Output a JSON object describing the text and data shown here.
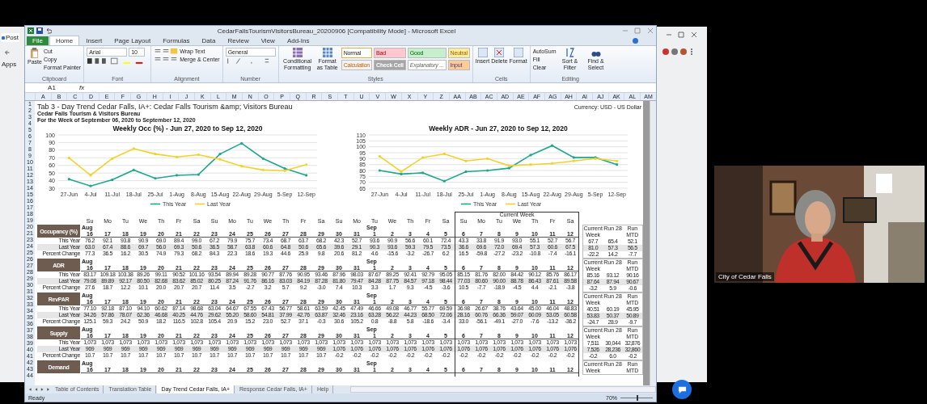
{
  "browser": {
    "tab_title": "Post",
    "bookmark": "Apps"
  },
  "excel": {
    "title": "CedarFallsTourismVisitorsBureau_20200906 [Compatibility Mode] - Microsoft Excel",
    "ribbon_tabs": [
      {
        "label": "File",
        "kind": "file",
        "selected": false
      },
      {
        "label": "Home",
        "kind": "tab",
        "selected": true
      },
      {
        "label": "Insert",
        "kind": "tab",
        "selected": false
      },
      {
        "label": "Page Layout",
        "kind": "tab",
        "selected": false
      },
      {
        "label": "Formulas",
        "kind": "tab",
        "selected": false
      },
      {
        "label": "Data",
        "kind": "tab",
        "selected": false
      },
      {
        "label": "Review",
        "kind": "tab",
        "selected": false
      },
      {
        "label": "View",
        "kind": "tab",
        "selected": false
      },
      {
        "label": "Add-Ins",
        "kind": "tab",
        "selected": false
      }
    ],
    "clipboard": {
      "paste": "Paste",
      "cut": "Cut",
      "copy": "Copy",
      "format_painter": "Format Painter",
      "label": "Clipboard"
    },
    "font": {
      "name": "Arial",
      "size": "10",
      "label": "Font"
    },
    "alignment": {
      "wrap": "Wrap Text",
      "merge": "Merge & Center",
      "label": "Alignment"
    },
    "number": {
      "format": "General",
      "label": "Number"
    },
    "styles": {
      "conditional": "Conditional Formatting",
      "format_table": "Format as Table",
      "label": "Styles",
      "cells": [
        {
          "label": "Normal",
          "kind": "normal"
        },
        {
          "label": "Bad",
          "kind": "bad"
        },
        {
          "label": "Good",
          "kind": "good"
        },
        {
          "label": "Neutral",
          "kind": "neutral"
        },
        {
          "label": "Calculation",
          "kind": "calculation"
        },
        {
          "label": "Check Cell",
          "kind": "check"
        },
        {
          "label": "Explanatory ...",
          "kind": "explanatory"
        },
        {
          "label": "Input",
          "kind": "input"
        }
      ]
    },
    "cells": {
      "insert": "Insert",
      "delete": "Delete",
      "format": "Format",
      "label": "Cells"
    },
    "editing": {
      "autosum": "AutoSum",
      "fill": "Fill",
      "clear": "Clear",
      "sort": "Sort & Filter",
      "find": "Find & Select",
      "label": "Editing"
    },
    "name_box": "A1",
    "formula_label": "fx",
    "column_letters": [
      "A",
      "B",
      "C",
      "D",
      "E",
      "F",
      "G",
      "H",
      "I",
      "J",
      "K",
      "L",
      "M",
      "N",
      "O",
      "P",
      "Q",
      "R",
      "S",
      "T",
      "U",
      "V",
      "W",
      "X",
      "Y",
      "Z",
      "AA",
      "AB",
      "AC",
      "AD",
      "AE",
      "AF",
      "AG",
      "AH",
      "AI",
      "AJ",
      "AK",
      "AL",
      "AM"
    ],
    "row_numbers": [
      "1",
      "2",
      "3",
      "4",
      "5",
      "6",
      "7",
      "8",
      "9",
      "10",
      "11",
      "12",
      "13",
      "14",
      "15",
      "16",
      "17",
      "18",
      "19",
      "20",
      "21",
      "23",
      "24",
      "25",
      "26",
      "27",
      "28",
      "29",
      "30",
      "31",
      "32",
      "33",
      "34",
      "35",
      "36",
      "37",
      "38",
      "39",
      "40",
      "41",
      "42",
      "43",
      "44"
    ],
    "sheet": {
      "title": "Tab 3 - Day Trend Cedar Falls, IA+: Cedar Falls Tourism &amp; Visitors Bureau",
      "subtitle": "Cedar Falls Tourism & Visitors Bureau",
      "period": "For the Week of September 06, 2020 to September 12, 2020",
      "currency": "Currency: USD - US Dollar",
      "charts": [
        {
          "chart_data": {
            "type": "line",
            "title": "Weekly Occ (%) - Jun 27, 2020 to Sep 12, 2020",
            "categories": [
              "27-Jun",
              "4-Jul",
              "11-Jul",
              "18-Jul",
              "25-Jul",
              "1-Aug",
              "8-Aug",
              "15-Aug",
              "22-Aug",
              "29-Aug",
              "5-Sep",
              "12-Sep"
            ],
            "ylim": [
              30,
              100
            ],
            "yticks": [
              30,
              40,
              50,
              60,
              70,
              80,
              90,
              100
            ],
            "grid": true,
            "legend": "bottom",
            "series": [
              {
                "name": "This Year",
                "color": "#1fa68e",
                "values": [
                  42,
                  33,
                  41,
                  54,
                  43,
                  47,
                  48,
                  75,
                  89,
                  69,
                  56,
                  47
                ]
              },
              {
                "name": "Last Year",
                "color": "#f2d22a",
                "values": [
                  70,
                  47,
                  69,
                  82,
                  75,
                  71,
                  74,
                  68,
                  59,
                  54,
                  53,
                  61
                ]
              }
            ]
          }
        },
        {
          "chart_data": {
            "type": "line",
            "title": "Weekly ADR - Jun 27, 2020 to Sep 12, 2020",
            "categories": [
              "27-Jun",
              "4-Jul",
              "11-Jul",
              "18-Jul",
              "25-Jul",
              "1-Aug",
              "8-Aug",
              "15-Aug",
              "22-Aug",
              "29-Aug",
              "5-Sep",
              "12-Sep"
            ],
            "ylim": [
              65,
              110
            ],
            "yticks": [
              65,
              70,
              75,
              80,
              85,
              90,
              95,
              100,
              105,
              110
            ],
            "grid": true,
            "legend": "bottom",
            "series": [
              {
                "name": "This Year",
                "color": "#1fa68e",
                "values": [
                  80,
                  77,
                  78,
                  71,
                  79,
                  80,
                  82,
                  93,
                  101,
                  91,
                  91,
                  85
                ]
              },
              {
                "name": "Last Year",
                "color": "#f2d22a",
                "values": [
                  92,
                  79,
                  91,
                  94,
                  88,
                  90,
                  84,
                  85,
                  86,
                  88,
                  90,
                  88
                ]
              }
            ]
          }
        }
      ],
      "table": {
        "current_week_label": "Current Week",
        "weekdays": [
          "Su",
          "Mo",
          "Tu",
          "We",
          "Th",
          "Fr",
          "Sa",
          "Su",
          "Mo",
          "Tu",
          "We",
          "Th",
          "Fr",
          "Sa",
          "Su",
          "Mo",
          "Tu",
          "We",
          "Th",
          "Fr",
          "Sa",
          "Su",
          "Mo",
          "Tu",
          "We",
          "Th",
          "Fr",
          "Sa"
        ],
        "sections": [
          {
            "label": "Occupancy (%)",
            "groups": [
              {
                "month": "Aug",
                "days": [
                  "16",
                  "17",
                  "18",
                  "19",
                  "20",
                  "21",
                  "22",
                  "23",
                  "24",
                  "25",
                  "26",
                  "27",
                  "28",
                  "29",
                  "30",
                  "31"
                ]
              },
              {
                "month": "Sep",
                "days": [
                  "1",
                  "2",
                  "3",
                  "4",
                  "5"
                ]
              },
              {
                "days": [
                  "6",
                  "7",
                  "8",
                  "9",
                  "10",
                  "11",
                  "12"
                ]
              }
            ],
            "summary_header": [
              "Current Week",
              "Run 28",
              "Run MTD"
            ],
            "rows": [
              {
                "label": "This Year",
                "values": [
                  "76.2",
                  "92.1",
                  "93.8",
                  "90.9",
                  "69.0",
                  "89.4",
                  "99.0",
                  "67.2",
                  "79.9",
                  "75.7",
                  "73.4",
                  "68.7",
                  "63.7",
                  "68.2",
                  "42.3",
                  "52.7",
                  "93.6",
                  "90.9",
                  "56.6",
                  "60.1",
                  "72.4",
                  "43.3",
                  "33.8",
                  "91.9",
                  "93.0",
                  "55.1",
                  "52.7",
                  "56.7"
                ],
                "summary": [
                  "67.7",
                  "65.4",
                  "52.1"
                ]
              },
              {
                "label": "Last Year",
                "values": [
                  "63.0",
                  "67.4",
                  "88.6",
                  "69.7",
                  "56.0",
                  "69.3",
                  "50.6",
                  "36.5",
                  "58.7",
                  "63.8",
                  "60.6",
                  "64.8",
                  "50.6",
                  "65.6",
                  "39.6",
                  "29.1",
                  "90.3",
                  "93.6",
                  "59.3",
                  "79.5",
                  "73.5",
                  "36.6",
                  "69.6",
                  "72.0",
                  "69.4",
                  "57.3",
                  "60.6",
                  "67.5"
                ],
                "summary": [
                  "81.0",
                  "57.3",
                  "56.5"
                ]
              },
              {
                "label": "Percent Change",
                "values": [
                  "77.3",
                  "36.5",
                  "16.2",
                  "30.5",
                  "74.9",
                  "79.3",
                  "68.2",
                  "84.3",
                  "22.3",
                  "18.6",
                  "19.3",
                  "44.6",
                  "25.9",
                  "9.8",
                  "20.6",
                  "81.2",
                  "4.6",
                  "-15.6",
                  "-3.2",
                  "-26.7",
                  "6.2",
                  "16.5",
                  "-59.8",
                  "-27.2",
                  "-23.2",
                  "-10.8",
                  "-7.4",
                  "-16.1"
                ],
                "summary": [
                  "-22.2",
                  "14.2",
                  "-7.7"
                ]
              }
            ]
          },
          {
            "label": "ADR",
            "groups": [
              {
                "month": "Aug",
                "days": [
                  "16",
                  "17",
                  "18",
                  "19",
                  "20",
                  "21",
                  "22",
                  "23",
                  "24",
                  "25",
                  "26",
                  "27",
                  "28",
                  "29",
                  "30",
                  "31"
                ]
              },
              {
                "month": "Sep",
                "days": [
                  "1",
                  "2",
                  "3",
                  "4",
                  "5"
                ]
              },
              {
                "days": [
                  "6",
                  "7",
                  "8",
                  "9",
                  "10",
                  "11",
                  "12"
                ]
              }
            ],
            "summary_header": [
              "Current Week",
              "Run 28",
              "Run MTD"
            ],
            "rows": [
              {
                "label": "This Year",
                "values": [
                  "83.17",
                  "109.18",
                  "103.38",
                  "89.26",
                  "99.11",
                  "90.52",
                  "101.16",
                  "93.54",
                  "89.94",
                  "89.28",
                  "90.77",
                  "87.76",
                  "90.95",
                  "93.46",
                  "87.96",
                  "98.03",
                  "87.67",
                  "89.25",
                  "92.41",
                  "92.79",
                  "95.05",
                  "85.15",
                  "81.76",
                  "82.00",
                  "84.42",
                  "90.12",
                  "85.76",
                  "86.17"
                ],
                "summary": [
                  "85.16",
                  "93.12",
                  "90.16"
                ]
              },
              {
                "label": "Last Year",
                "values": [
                  "79.08",
                  "89.89",
                  "92.17",
                  "80.50",
                  "82.68",
                  "83.62",
                  "85.02",
                  "80.25",
                  "87.24",
                  "91.76",
                  "86.16",
                  "83.03",
                  "84.19",
                  "87.28",
                  "81.80",
                  "79.47",
                  "84.28",
                  "87.75",
                  "84.57",
                  "97.18",
                  "98.44",
                  "77.03",
                  "80.60",
                  "90.00",
                  "88.78",
                  "86.43",
                  "87.61",
                  "89.58"
                ],
                "summary": [
                  "87.64",
                  "87.94",
                  "90.67"
                ]
              },
              {
                "label": "Percent Change",
                "values": [
                  "27.6",
                  "18.7",
                  "12.2",
                  "10.1",
                  "20.0",
                  "20.7",
                  "20.7",
                  "11.4",
                  "3.5",
                  "-2.7",
                  "3.2",
                  "5.7",
                  "9.2",
                  "-3.0",
                  "7.4",
                  "10.3",
                  "3.3",
                  "1.7",
                  "9.3",
                  "-4.5",
                  "-3.6",
                  "10.5",
                  "-7.7",
                  "-18.9",
                  "-4.5",
                  "4.4",
                  "-2.1",
                  "-3.8"
                ],
                "summary": [
                  "-3.2",
                  "5.9",
                  "-0.6"
                ]
              }
            ]
          },
          {
            "label": "RevPAR",
            "groups": [
              {
                "month": "Aug",
                "days": [
                  "16",
                  "17",
                  "18",
                  "19",
                  "20",
                  "21",
                  "22",
                  "23",
                  "24",
                  "25",
                  "26",
                  "27",
                  "28",
                  "29",
                  "30",
                  "31"
                ]
              },
              {
                "month": "Sep",
                "days": [
                  "1",
                  "2",
                  "3",
                  "4",
                  "5"
                ]
              },
              {
                "days": [
                  "6",
                  "7",
                  "8",
                  "9",
                  "10",
                  "11",
                  "12"
                ]
              }
            ],
            "summary_header": [
              "Current Week",
              "Run 28",
              "Run MTD"
            ],
            "rows": [
              {
                "label": "This Year",
                "values": [
                  "77.10",
                  "92.18",
                  "87.10",
                  "94.10",
                  "60.62",
                  "87.14",
                  "98.68",
                  "63.04",
                  "64.67",
                  "67.55",
                  "67.43",
                  "56.77",
                  "58.61",
                  "63.59",
                  "42.45",
                  "47.49",
                  "46.66",
                  "49.08",
                  "46.77",
                  "55.77",
                  "69.59",
                  "36.98",
                  "26.67",
                  "38.76",
                  "43.64",
                  "45.00",
                  "46.04",
                  "48.83"
                ],
                "summary": [
                  "40.51",
                  "60.19",
                  "45.95"
                ]
              },
              {
                "label": "Last Year",
                "values": [
                  "34.26",
                  "57.86",
                  "78.07",
                  "62.36",
                  "46.68",
                  "40.25",
                  "44.76",
                  "29.62",
                  "55.20",
                  "58.60",
                  "54.81",
                  "37.99",
                  "42.76",
                  "63.87",
                  "32.46",
                  "23.16",
                  "63.28",
                  "56.22",
                  "44.23",
                  "68.50",
                  "72.06",
                  "28.16",
                  "60.76",
                  "66.36",
                  "59.07",
                  "60.09",
                  "53.05",
                  "60.58"
                ],
                "summary": [
                  "53.83",
                  "50.37",
                  "50.89"
                ]
              },
              {
                "label": "Percent Change",
                "values": [
                  "125.1",
                  "59.3",
                  "24.2",
                  "50.9",
                  "18.2",
                  "116.5",
                  "102.8",
                  "105.4",
                  "20.9",
                  "15.2",
                  "23.0",
                  "52.7",
                  "37.1",
                  "-0.3",
                  "30.6",
                  "105.2",
                  "0.8",
                  "-8.8",
                  "5.8",
                  "-18.6",
                  "-3.4",
                  "33.0",
                  "-56.1",
                  "-49.1",
                  "-27.0",
                  "-7.6",
                  "-13.2",
                  "-36.2"
                ],
                "summary": [
                  "-24.7",
                  "28.9",
                  "-9.7"
                ]
              }
            ]
          },
          {
            "label": "Supply",
            "groups": [
              {
                "month": "Aug",
                "days": [
                  "16",
                  "17",
                  "18",
                  "19",
                  "20",
                  "21",
                  "22",
                  "23",
                  "24",
                  "25",
                  "26",
                  "27",
                  "28",
                  "29",
                  "30",
                  "31"
                ]
              },
              {
                "month": "Sep",
                "days": [
                  "1",
                  "2",
                  "3",
                  "4",
                  "5"
                ]
              },
              {
                "days": [
                  "6",
                  "7",
                  "8",
                  "9",
                  "10",
                  "11",
                  "12"
                ]
              }
            ],
            "summary_header": [
              "Current Week",
              "Run 28",
              "Run MTD"
            ],
            "rows": [
              {
                "label": "This Year",
                "values": [
                  "1,073",
                  "1,073",
                  "1,073",
                  "1,073",
                  "1,073",
                  "1,073",
                  "1,073",
                  "1,073",
                  "1,073",
                  "1,073",
                  "1,073",
                  "1,073",
                  "1,073",
                  "1,073",
                  "1,073",
                  "1,073",
                  "1,073",
                  "1,073",
                  "1,073",
                  "1,073",
                  "1,073",
                  "1,073",
                  "1,073",
                  "1,073",
                  "1,073",
                  "1,073",
                  "1,073",
                  "1,073"
                ],
                "summary": [
                  "7,511",
                  "30,044",
                  "32,876"
                ]
              },
              {
                "label": "Last Year",
                "values": [
                  "969",
                  "969",
                  "969",
                  "969",
                  "969",
                  "969",
                  "969",
                  "969",
                  "969",
                  "969",
                  "969",
                  "969",
                  "969",
                  "969",
                  "1,076",
                  "1,076",
                  "1,076",
                  "1,076",
                  "1,076",
                  "1,076",
                  "1,076",
                  "1,076",
                  "1,076",
                  "1,076",
                  "1,076",
                  "1,076",
                  "1,076",
                  "1,076"
                ],
                "summary": [
                  "7,526",
                  "28,236",
                  "32,860"
                ]
              },
              {
                "label": "Percent Change",
                "values": [
                  "10.7",
                  "10.7",
                  "10.7",
                  "10.7",
                  "10.7",
                  "10.7",
                  "10.7",
                  "10.7",
                  "10.7",
                  "10.7",
                  "10.7",
                  "10.7",
                  "10.7",
                  "10.7",
                  "-0.2",
                  "-0.2",
                  "-0.2",
                  "-0.2",
                  "-0.2",
                  "-0.2",
                  "-0.2",
                  "-0.2",
                  "-0.2",
                  "-0.2",
                  "-0.2",
                  "-0.2",
                  "-0.2",
                  "-0.2"
                ],
                "summary": [
                  "-0.2",
                  "6.0",
                  "-0.2"
                ]
              }
            ]
          },
          {
            "label": "Demand",
            "groups": [
              {
                "month": "Aug",
                "days": [
                  "16",
                  "17",
                  "18",
                  "19",
                  "20",
                  "21",
                  "22",
                  "23",
                  "24",
                  "25",
                  "26",
                  "27",
                  "28",
                  "29",
                  "30",
                  "31"
                ]
              },
              {
                "month": "Sep",
                "days": [
                  "1",
                  "2",
                  "3",
                  "4",
                  "5"
                ]
              },
              {
                "days": [
                  "6",
                  "7",
                  "8",
                  "9",
                  "10",
                  "11",
                  "12"
                ]
              }
            ],
            "summary_header": [
              "Current Week",
              "Run 28",
              "Run MTD"
            ]
          }
        ]
      }
    },
    "sheet_tabs": [
      {
        "label": "Table of Contents",
        "selected": false
      },
      {
        "label": "Translation Table",
        "selected": false
      },
      {
        "label": "Day Trend Cedar Falls, IA+",
        "selected": true
      },
      {
        "label": "Response Cedar Falls, IA+",
        "selected": false
      },
      {
        "label": "Help",
        "selected": false
      }
    ],
    "status": {
      "text": "Ready",
      "zoom": "70%",
      "level": 0.5
    }
  },
  "video": {
    "name": "City of Cedar Falls"
  }
}
